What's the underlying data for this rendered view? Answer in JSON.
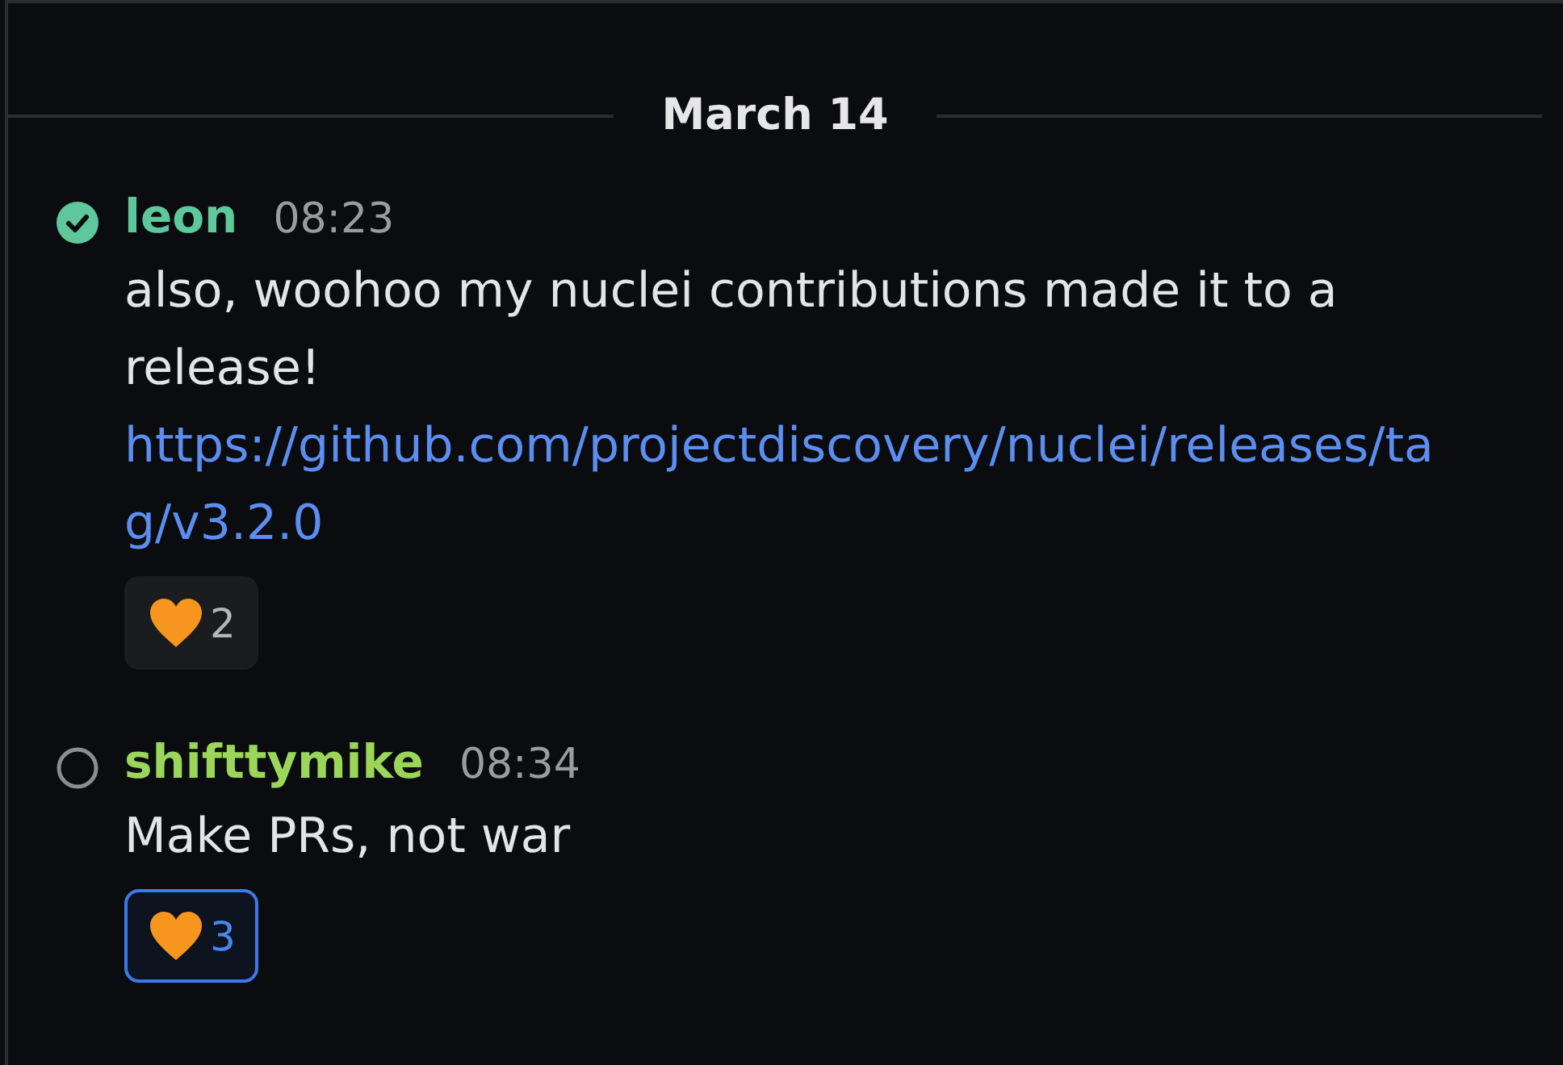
{
  "date_divider": "March 14",
  "messages": [
    {
      "author": "leon",
      "color": "#5ec79b",
      "verified": true,
      "time": "08:23",
      "text": "also, woohoo my nuclei contributions made it to a release!",
      "link": "https://github.com/projectdiscovery/nuclei/releases/tag/v3.2.0",
      "reactions": [
        {
          "count": "2",
          "selected": false
        }
      ]
    },
    {
      "author": "shifttymike",
      "color": "#9bd65a",
      "verified": false,
      "time": "08:34",
      "text": "Make PRs, not war",
      "reactions": [
        {
          "count": "3",
          "selected": true
        }
      ]
    }
  ]
}
